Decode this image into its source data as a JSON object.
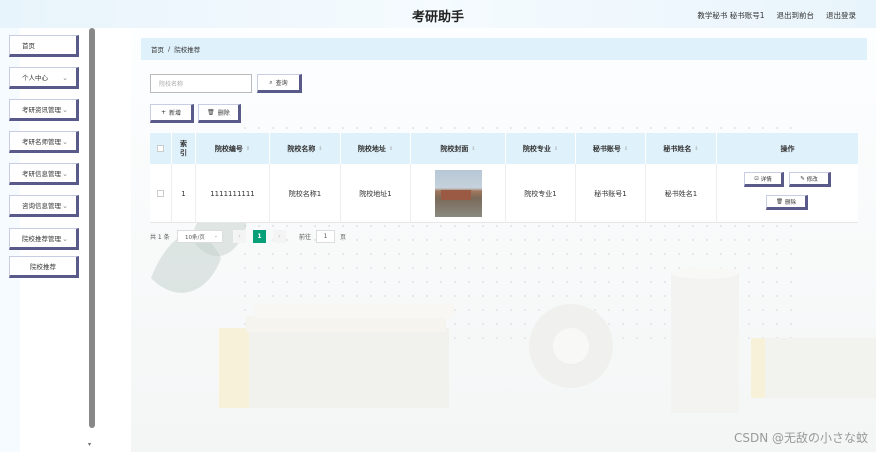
{
  "app": {
    "title": "考研助手"
  },
  "top_links": {
    "user": "教学秘书 秘书账号1",
    "front": "退出到前台",
    "logout": "退出登录"
  },
  "sidebar": {
    "items": [
      {
        "label": "首页",
        "has_arrow": false
      },
      {
        "label": "个人中心",
        "has_arrow": true
      },
      {
        "label": "考研资讯管理",
        "has_arrow": true
      },
      {
        "label": "考研名师管理",
        "has_arrow": true
      },
      {
        "label": "考研信息管理",
        "has_arrow": true
      },
      {
        "label": "咨询信息管理",
        "has_arrow": true
      },
      {
        "label": "院校推荐管理",
        "has_arrow": true
      }
    ],
    "sub_item": "院校推荐"
  },
  "breadcrumb": {
    "home": "首页",
    "sep": "/",
    "current": "院校推荐"
  },
  "search": {
    "placeholder": "院校名称",
    "button": "查询"
  },
  "actions": {
    "add": "新增",
    "delete": "删除"
  },
  "table": {
    "headers": [
      "索引",
      "院校编号",
      "院校名称",
      "院校地址",
      "院校封面",
      "院校专业",
      "秘书账号",
      "秘书姓名",
      "操作"
    ],
    "rows": [
      {
        "index": "1",
        "code": "1111111111",
        "name": "院校名称1",
        "address": "院校地址1",
        "major": "院校专业1",
        "account": "秘书账号1",
        "secretary": "秘书姓名1"
      }
    ],
    "ops": {
      "detail": "详情",
      "edit": "修改",
      "delete": "删除"
    }
  },
  "pagination": {
    "total": "共 1 条",
    "page_size": "10条/页",
    "current": "1",
    "goto_label": "前往",
    "goto_value": "1",
    "page_unit": "页"
  },
  "watermark": "CSDN @无敌の小さな蚊",
  "colors": {
    "accent_green": "#09a079",
    "header_bg": "#dff1fb",
    "border_dark": "#5a5a8a"
  }
}
